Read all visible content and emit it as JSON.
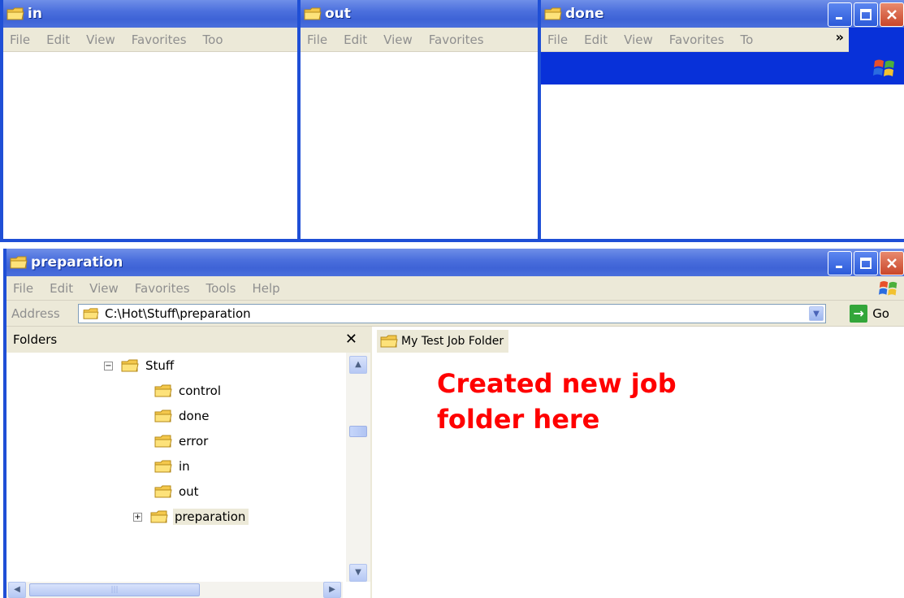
{
  "windows": {
    "in": {
      "title": "in",
      "menu": [
        "File",
        "Edit",
        "View",
        "Favorites",
        "Too"
      ]
    },
    "out": {
      "title": "out",
      "menu": [
        "File",
        "Edit",
        "View",
        "Favorites"
      ]
    },
    "done": {
      "title": "done",
      "menu": [
        "File",
        "Edit",
        "View",
        "Favorites",
        "To"
      ],
      "chevron": "»"
    }
  },
  "main": {
    "title": "preparation",
    "menu": [
      "File",
      "Edit",
      "View",
      "Favorites",
      "Tools",
      "Help"
    ],
    "address": {
      "label": "Address",
      "value": "C:\\Hot\\Stuff\\preparation",
      "go_label": "Go"
    },
    "folders_pane": {
      "title": "Folders",
      "close_glyph": "✕",
      "tree": [
        {
          "label": "Stuff",
          "expander": "⊟"
        },
        {
          "label": "control"
        },
        {
          "label": "done"
        },
        {
          "label": "error"
        },
        {
          "label": "in"
        },
        {
          "label": "out"
        },
        {
          "label": "preparation",
          "expander": "⊞",
          "selected": true
        }
      ]
    },
    "content": {
      "items": [
        {
          "label": "My Test Job Folder"
        }
      ],
      "annotation_line1": "Created new job",
      "annotation_line2": "folder here"
    }
  },
  "colors": {
    "title_blue": "#3e63d6",
    "annotation_red": "#ff0000",
    "menu_bg": "#ece9d8",
    "folder_yellow": "#f4c84c"
  },
  "icons": {
    "folder": "folder-icon",
    "minimize": "minimize-icon",
    "maximize": "maximize-icon",
    "close": "close-icon",
    "go": "go-arrow-icon",
    "windows_logo": "windows-logo-icon"
  }
}
